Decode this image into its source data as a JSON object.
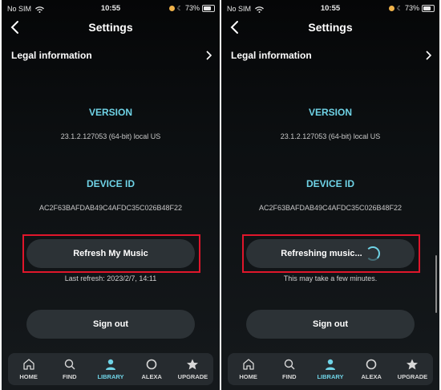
{
  "colors": {
    "accent": "#6fd3e6",
    "highlight": "#e0162b",
    "button_bg": "#2c3236"
  },
  "status_bar": {
    "carrier": "No SIM",
    "time": "10:55",
    "battery": "73%",
    "battery_level": 0.73
  },
  "header": {
    "title": "Settings"
  },
  "legal": {
    "label": "Legal information"
  },
  "version": {
    "label": "VERSION",
    "value": "23.1.2.127053 (64-bit) local US"
  },
  "device": {
    "label": "DEVICE ID",
    "value": "AC2F63BAFDAB49C4AFDC35C026B48F22"
  },
  "left_screen": {
    "refresh_button": "Refresh My Music",
    "last_refresh": "Last refresh: 2023/2/7, 14:11",
    "sign_out": "Sign out"
  },
  "right_screen": {
    "refresh_button": "Refreshing music...",
    "note": "This may take a few minutes.",
    "sign_out": "Sign out"
  },
  "tabs": [
    {
      "label": "HOME",
      "icon": "home-icon",
      "active": false
    },
    {
      "label": "FIND",
      "icon": "search-icon",
      "active": false
    },
    {
      "label": "LIBRARY",
      "icon": "person-icon",
      "active": true
    },
    {
      "label": "ALEXA",
      "icon": "alexa-ring-icon",
      "active": false
    },
    {
      "label": "UPGRADE",
      "icon": "star-icon",
      "active": false
    }
  ]
}
